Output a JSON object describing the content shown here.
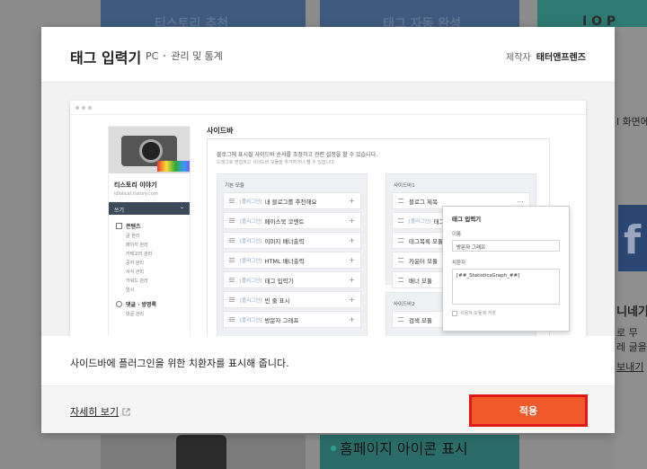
{
  "background": {
    "top_texts": [
      "티스토리 추천",
      "태그 자동 완성",
      "I O P"
    ],
    "side_texts": [
      "l 화면에",
      "니네기",
      "로 무",
      "레 글을 블",
      "보내기"
    ],
    "bottom_label": "홈페이지 아이콘 표시"
  },
  "modal": {
    "title": "태그 입력기",
    "platform": "PC",
    "category": "관리 및 통계",
    "maker_label": "제작자",
    "maker_name": "태터앤프렌즈",
    "message": "사이드바에 플러그인을 위한 치환자를 표시해 줍니다.",
    "more_link": "자세히 보기",
    "apply_button": "적용"
  },
  "preview": {
    "blog": {
      "name": "티스토리 이야기",
      "url": "idlolicat.tistory.com",
      "write": "쓰기",
      "section1": "콘텐츠",
      "section1_items": [
        "글 관리",
        "페이지 관리",
        "카테고리 관리",
        "공지 관리",
        "서식 관리",
        "키워드 관리",
        "임시"
      ],
      "section2": "댓글 · 방명록",
      "section2_items": [
        "댓글 관리"
      ]
    },
    "sidebar_title": "사이드바",
    "desc1": "블로그에 표시될 사이드바 순서를 조정하고 관련 설정을 할 수 있습니다.",
    "desc2": "드래그로 편집하고 사이드바 모듈을 추가하거나 뺄 수 있습니다.",
    "basic_head": "기본 모듈",
    "tag_prefix": "[플러그인]",
    "basic_modules": [
      "내 블로그를 추천해요",
      "페이스북 코멘트",
      "이미지 배너출력",
      "HTML 배너출력",
      "태그 입력기",
      "빈 줄 표시",
      "방문자 그래프"
    ],
    "sidebar1_head": "사이드바1",
    "sidebar1_items": [
      "블로그 제목",
      "태그",
      "태그목록 모듈",
      "카운터 모듈",
      "배너 모듈"
    ],
    "sidebar1_plugin_index": 1,
    "sidebar2_head": "사이드바2",
    "sidebar2_items": [
      "검색 모듈"
    ],
    "popup": {
      "title": "태그 입력기",
      "name_label": "이름",
      "name_value": "방문자 그래프",
      "sub_label": "치환자",
      "sub_value": "[##_StatisticsGraph_##]",
      "checkbox": "사용자 모듈에 저장"
    }
  }
}
